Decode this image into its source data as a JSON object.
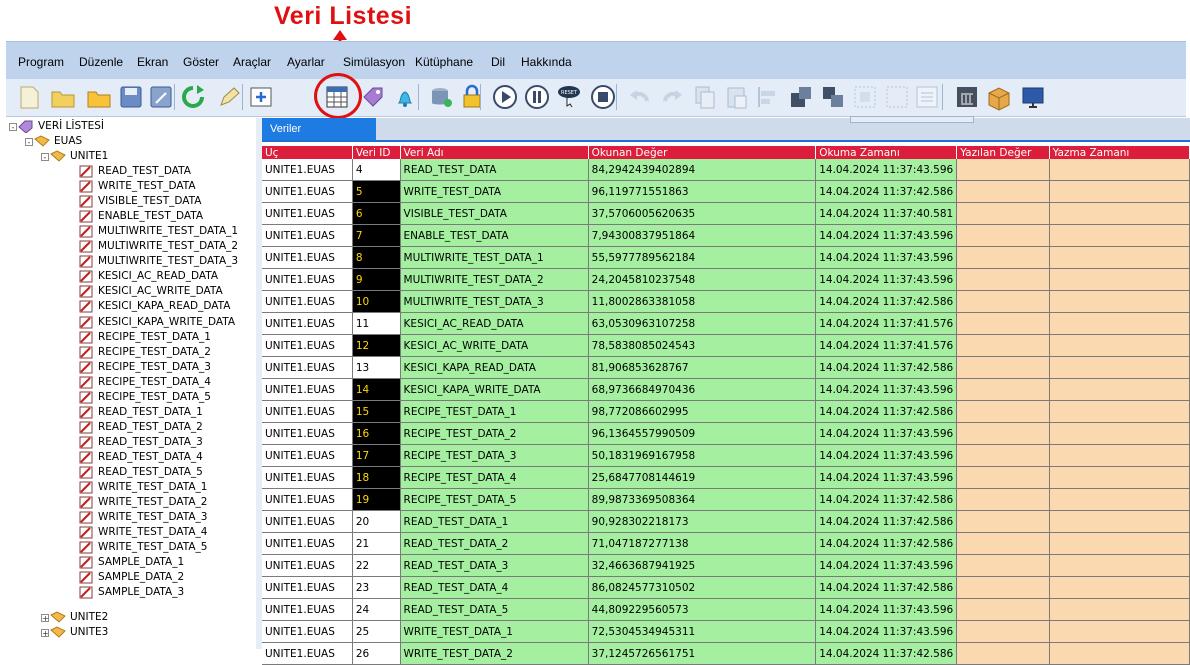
{
  "annotation": {
    "title": "Veri Listesi"
  },
  "menu": [
    "Program",
    "Düzenle",
    "Ekran",
    "Göster",
    "Araçlar",
    "Ayarlar",
    "Simülasyon",
    "Kütüphane",
    "Dil",
    "Hakkında"
  ],
  "toolbar": {
    "icons": [
      "new-icon",
      "open-icon",
      "open-folder-icon",
      "save-icon",
      "save-as-icon",
      "refresh-icon",
      "edit-icon",
      "add-frame-icon",
      "data-list-icon",
      "tag-icon",
      "alarm-bell-icon",
      "database-icon",
      "lock-icon",
      "play-icon",
      "pause-icon",
      "reset-icon",
      "stop-icon",
      "undo-icon",
      "redo-icon",
      "copy-icon",
      "paste-icon",
      "align-left-icon",
      "group-icon",
      "ungroup-icon",
      "bring-front-icon",
      "send-back-icon",
      "properties-icon",
      "bank-icon",
      "package-icon",
      "monitor-icon"
    ],
    "reset_label": "RESET"
  },
  "tree": {
    "root": "VERİ LİSTESİ",
    "euas": "EUAS",
    "unite1": "UNITE1",
    "items": [
      "READ_TEST_DATA",
      "WRITE_TEST_DATA",
      "VISIBLE_TEST_DATA",
      "ENABLE_TEST_DATA",
      "MULTIWRITE_TEST_DATA_1",
      "MULTIWRITE_TEST_DATA_2",
      "MULTIWRITE_TEST_DATA_3",
      "KESICI_AC_READ_DATA",
      "KESICI_AC_WRITE_DATA",
      "KESICI_KAPA_READ_DATA",
      "KESICI_KAPA_WRITE_DATA",
      "RECIPE_TEST_DATA_1",
      "RECIPE_TEST_DATA_2",
      "RECIPE_TEST_DATA_3",
      "RECIPE_TEST_DATA_4",
      "RECIPE_TEST_DATA_5",
      "READ_TEST_DATA_1",
      "READ_TEST_DATA_2",
      "READ_TEST_DATA_3",
      "READ_TEST_DATA_4",
      "READ_TEST_DATA_5",
      "WRITE_TEST_DATA_1",
      "WRITE_TEST_DATA_2",
      "WRITE_TEST_DATA_3",
      "WRITE_TEST_DATA_4",
      "WRITE_TEST_DATA_5",
      "SAMPLE_DATA_1",
      "SAMPLE_DATA_2",
      "SAMPLE_DATA_3"
    ],
    "unite2": "UNITE2",
    "unite3": "UNITE3"
  },
  "tab": "Veriler",
  "table": {
    "headers": [
      "Uç",
      "Veri ID",
      "Veri Adı",
      "Okunan Değer",
      "Okuma Zamanı",
      "Yazılan Değer",
      "Yazma Zamanı"
    ],
    "rows": [
      {
        "uc": "UNITE1.EUAS",
        "id": "4",
        "name": "READ_TEST_DATA",
        "value": "84,2942439402894",
        "time": "14.04.2024 11:37:43.596",
        "dark": false
      },
      {
        "uc": "UNITE1.EUAS",
        "id": "5",
        "name": "WRITE_TEST_DATA",
        "value": "96,119771551863",
        "time": "14.04.2024 11:37:42.586",
        "dark": true
      },
      {
        "uc": "UNITE1.EUAS",
        "id": "6",
        "name": "VISIBLE_TEST_DATA",
        "value": "37,5706005620635",
        "time": "14.04.2024 11:37:40.581",
        "dark": true
      },
      {
        "uc": "UNITE1.EUAS",
        "id": "7",
        "name": "ENABLE_TEST_DATA",
        "value": "7,94300837951864",
        "time": "14.04.2024 11:37:43.596",
        "dark": true
      },
      {
        "uc": "UNITE1.EUAS",
        "id": "8",
        "name": "MULTIWRITE_TEST_DATA_1",
        "value": "55,5977789562184",
        "time": "14.04.2024 11:37:43.596",
        "dark": true
      },
      {
        "uc": "UNITE1.EUAS",
        "id": "9",
        "name": "MULTIWRITE_TEST_DATA_2",
        "value": "24,2045810237548",
        "time": "14.04.2024 11:37:43.596",
        "dark": true
      },
      {
        "uc": "UNITE1.EUAS",
        "id": "10",
        "name": "MULTIWRITE_TEST_DATA_3",
        "value": "11,8002863381058",
        "time": "14.04.2024 11:37:42.586",
        "dark": true
      },
      {
        "uc": "UNITE1.EUAS",
        "id": "11",
        "name": "KESICI_AC_READ_DATA",
        "value": "63,0530963107258",
        "time": "14.04.2024 11:37:41.576",
        "dark": false
      },
      {
        "uc": "UNITE1.EUAS",
        "id": "12",
        "name": "KESICI_AC_WRITE_DATA",
        "value": "78,5838085024543",
        "time": "14.04.2024 11:37:41.576",
        "dark": true
      },
      {
        "uc": "UNITE1.EUAS",
        "id": "13",
        "name": "KESICI_KAPA_READ_DATA",
        "value": "81,906853628767",
        "time": "14.04.2024 11:37:42.586",
        "dark": false
      },
      {
        "uc": "UNITE1.EUAS",
        "id": "14",
        "name": "KESICI_KAPA_WRITE_DATA",
        "value": "68,9736684970436",
        "time": "14.04.2024 11:37:43.596",
        "dark": true
      },
      {
        "uc": "UNITE1.EUAS",
        "id": "15",
        "name": "RECIPE_TEST_DATA_1",
        "value": "98,772086602995",
        "time": "14.04.2024 11:37:42.586",
        "dark": true
      },
      {
        "uc": "UNITE1.EUAS",
        "id": "16",
        "name": "RECIPE_TEST_DATA_2",
        "value": "96,1364557990509",
        "time": "14.04.2024 11:37:43.596",
        "dark": true
      },
      {
        "uc": "UNITE1.EUAS",
        "id": "17",
        "name": "RECIPE_TEST_DATA_3",
        "value": "50,1831969167958",
        "time": "14.04.2024 11:37:43.596",
        "dark": true
      },
      {
        "uc": "UNITE1.EUAS",
        "id": "18",
        "name": "RECIPE_TEST_DATA_4",
        "value": "25,6847708144619",
        "time": "14.04.2024 11:37:43.596",
        "dark": true
      },
      {
        "uc": "UNITE1.EUAS",
        "id": "19",
        "name": "RECIPE_TEST_DATA_5",
        "value": "89,9873369508364",
        "time": "14.04.2024 11:37:42.586",
        "dark": true
      },
      {
        "uc": "UNITE1.EUAS",
        "id": "20",
        "name": "READ_TEST_DATA_1",
        "value": "90,928302218173",
        "time": "14.04.2024 11:37:42.586",
        "dark": false
      },
      {
        "uc": "UNITE1.EUAS",
        "id": "21",
        "name": "READ_TEST_DATA_2",
        "value": "71,047187277138",
        "time": "14.04.2024 11:37:42.586",
        "dark": false
      },
      {
        "uc": "UNITE1.EUAS",
        "id": "22",
        "name": "READ_TEST_DATA_3",
        "value": "32,4663687941925",
        "time": "14.04.2024 11:37:43.596",
        "dark": false
      },
      {
        "uc": "UNITE1.EUAS",
        "id": "23",
        "name": "READ_TEST_DATA_4",
        "value": "86,0824577310502",
        "time": "14.04.2024 11:37:42.586",
        "dark": false
      },
      {
        "uc": "UNITE1.EUAS",
        "id": "24",
        "name": "READ_TEST_DATA_5",
        "value": "44,809229560573",
        "time": "14.04.2024 11:37:43.596",
        "dark": false
      },
      {
        "uc": "UNITE1.EUAS",
        "id": "25",
        "name": "WRITE_TEST_DATA_1",
        "value": "72,5304534945311",
        "time": "14.04.2024 11:37:43.596",
        "dark": false
      },
      {
        "uc": "UNITE1.EUAS",
        "id": "26",
        "name": "WRITE_TEST_DATA_2",
        "value": "37,1245726561751",
        "time": "14.04.2024 11:37:42.586",
        "dark": false
      }
    ]
  },
  "colors": {
    "header_red": "#dc1e3c",
    "value_green": "#a4f0a0",
    "write_peach": "#fbd9b0",
    "tab_blue": "#1e7be2",
    "annotation_red": "#e01010"
  }
}
